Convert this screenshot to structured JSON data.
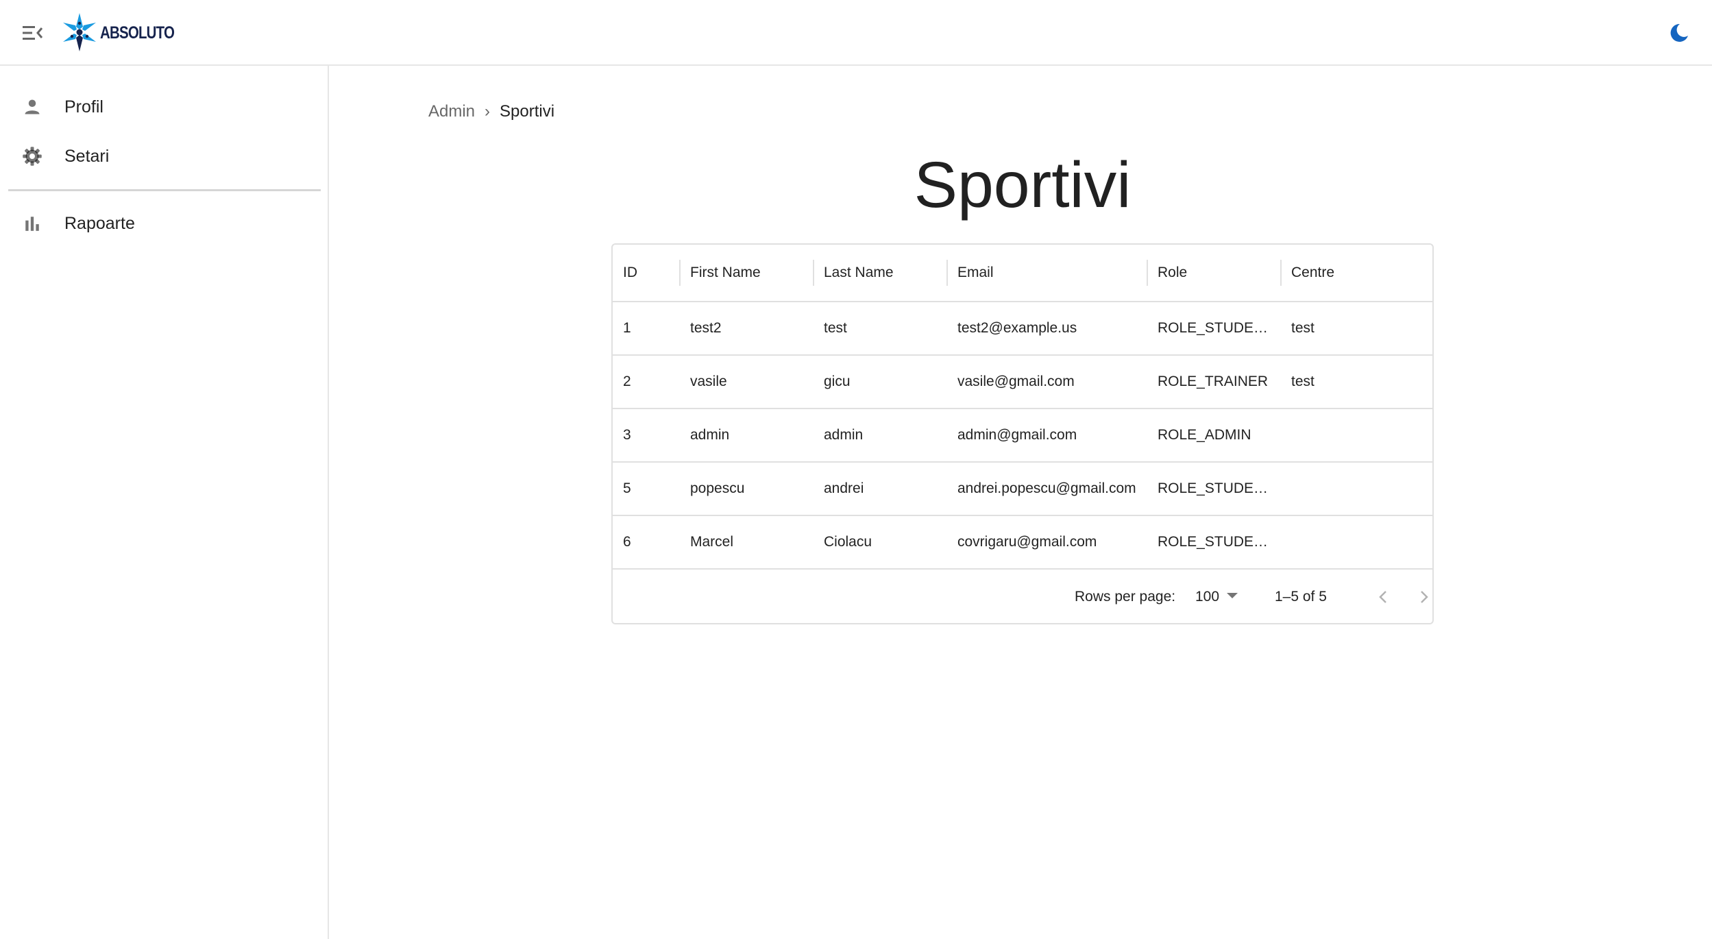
{
  "app": {
    "brand": "ABSOLUTO",
    "icons": {
      "menu": "menu-open-icon",
      "theme": "moon-icon",
      "logo": "star-logo-icon"
    },
    "accent": "#1565c0"
  },
  "sidebar": {
    "items": [
      {
        "label": "Profil",
        "icon": "person-icon"
      },
      {
        "label": "Setari",
        "icon": "gear-icon"
      },
      {
        "label": "Rapoarte",
        "icon": "bar-chart-icon"
      }
    ]
  },
  "breadcrumb": {
    "parent": "Admin",
    "separator": "›",
    "current": "Sportivi"
  },
  "page": {
    "title": "Sportivi"
  },
  "table": {
    "columns": [
      "ID",
      "First Name",
      "Last Name",
      "Email",
      "Role",
      "Centre"
    ],
    "rows": [
      [
        "1",
        "test2",
        "test",
        "test2@example.us",
        "ROLE_STUDENT",
        "test"
      ],
      [
        "2",
        "vasile",
        "gicu",
        "vasile@gmail.com",
        "ROLE_TRAINER",
        "test"
      ],
      [
        "3",
        "admin",
        "admin",
        "admin@gmail.com",
        "ROLE_ADMIN",
        ""
      ],
      [
        "5",
        "popescu",
        "andrei",
        "andrei.popescu@gmail.com",
        "ROLE_STUDENT",
        ""
      ],
      [
        "6",
        "Marcel",
        "Ciolacu",
        "covrigaru@gmail.com",
        "ROLE_STUDENT",
        ""
      ]
    ],
    "footer": {
      "rows_per_page_label": "Rows per page:",
      "rows_per_page_value": "100",
      "range": "1–5 of 5"
    }
  }
}
